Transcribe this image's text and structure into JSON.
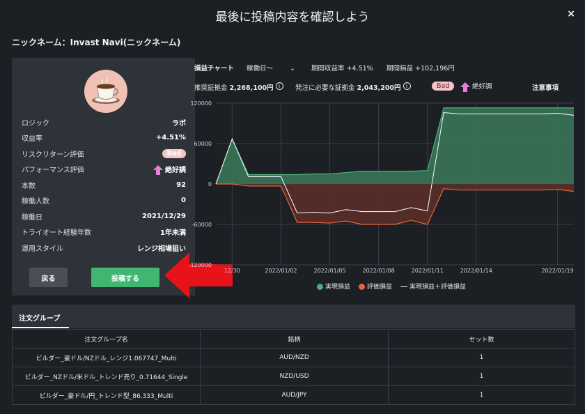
{
  "modal": {
    "title": "最後に投稿内容を確認しよう",
    "close_label": "×",
    "nickname": "ニックネーム：Invast Navi(ニックネーム)"
  },
  "card": {
    "avatar_icon": "coffee-cup-icon",
    "rows": [
      {
        "label": "ロジック",
        "value": "ラボ"
      },
      {
        "label": "収益率",
        "value": "+4.51%"
      },
      {
        "label": "リスクリターン評価",
        "value": "Bad"
      },
      {
        "label": "パフォーマンス評価",
        "value": "絶好調"
      },
      {
        "label": "本数",
        "value": "92"
      },
      {
        "label": "稼働人数",
        "value": "0"
      },
      {
        "label": "稼働日",
        "value": "2021/12/29"
      },
      {
        "label": "トライオート経験年数",
        "value": "1年未満"
      },
      {
        "label": "運用スタイル",
        "value": "レンジ相場狙い"
      }
    ],
    "back_label": "戻る",
    "post_label": "投稿する"
  },
  "chart_header": {
    "chart_label": "損益チャート",
    "period_select": "稼働日〜",
    "period_return_label": "期間収益率",
    "period_return_value": "+4.51%",
    "period_pl_label": "期間損益",
    "period_pl_value": "+102,196円",
    "rec_margin_label": "推奨証拠金",
    "rec_margin_value": "2,268,100円",
    "order_margin_label": "発注に必要な証拠金",
    "order_margin_value": "2,043,200円",
    "risk_badge": "Bad",
    "perf_label": "絶好調",
    "notes_label": "注意事項",
    "info_icon": "i"
  },
  "chart_data": {
    "type": "area",
    "x": [
      "2021/12/29",
      "2021/12/30",
      "2021/12/31",
      "2022/01/01",
      "2022/01/02",
      "2022/01/03",
      "2022/01/04",
      "2022/01/05",
      "2022/01/06",
      "2022/01/07",
      "2022/01/08",
      "2022/01/09",
      "2022/01/10",
      "2022/01/11",
      "2022/01/12",
      "2022/01/13",
      "2022/01/14",
      "2022/01/15",
      "2022/01/16",
      "2022/01/17",
      "2022/01/18",
      "2022/01/19",
      "2022/01/20"
    ],
    "xticks": [
      "12/30",
      "2022/01/02",
      "2022/01/05",
      "2022/01/08",
      "2022/01/11",
      "2022/01/14",
      "2022/01/19"
    ],
    "yticks": [
      "120000",
      "60000",
      "0",
      "-60000",
      "-120000"
    ],
    "ylim": [
      -120000,
      120000
    ],
    "series": [
      {
        "name": "実現損益",
        "color": "#4caf7a",
        "values": [
          0,
          67000,
          14000,
          14000,
          14000,
          14000,
          15000,
          15000,
          17000,
          19000,
          19000,
          19000,
          19000,
          20000,
          113000,
          113000,
          113000,
          113000,
          113000,
          113000,
          113000,
          113000,
          113000
        ]
      },
      {
        "name": "評価損益",
        "color": "#e8643c",
        "values": [
          0,
          0,
          -3000,
          -3000,
          -3000,
          -57000,
          -57000,
          -58000,
          -55000,
          -60000,
          -60000,
          -60000,
          -54000,
          -60000,
          -7000,
          -9000,
          -9000,
          -9000,
          -9000,
          -9000,
          -9000,
          -8000,
          -11000
        ]
      },
      {
        "name": "実現損益＋評価損益",
        "color": "#ffffff",
        "values": [
          0,
          67000,
          11000,
          11000,
          11000,
          -43000,
          -42000,
          -43000,
          -38000,
          -41000,
          -41000,
          -41000,
          -35000,
          -40000,
          106000,
          104000,
          104000,
          104000,
          104000,
          104000,
          104000,
          105000,
          102000
        ]
      }
    ]
  },
  "table": {
    "tab_label": "注文グループ",
    "columns": [
      "注文グループ名",
      "銘柄",
      "セット数"
    ],
    "rows": [
      [
        "ビルダー_豪ドル/NZドル_レンジ1.067747_Multi",
        "AUD/NZD",
        "1"
      ],
      [
        "ビルダー_NZドル/米ドル_トレンド売り_0.71644_Single",
        "NZD/USD",
        "1"
      ],
      [
        "ビルダー_豪ドル/円_トレンド型_86.333_Multi",
        "AUD/JPY",
        "1"
      ]
    ]
  }
}
